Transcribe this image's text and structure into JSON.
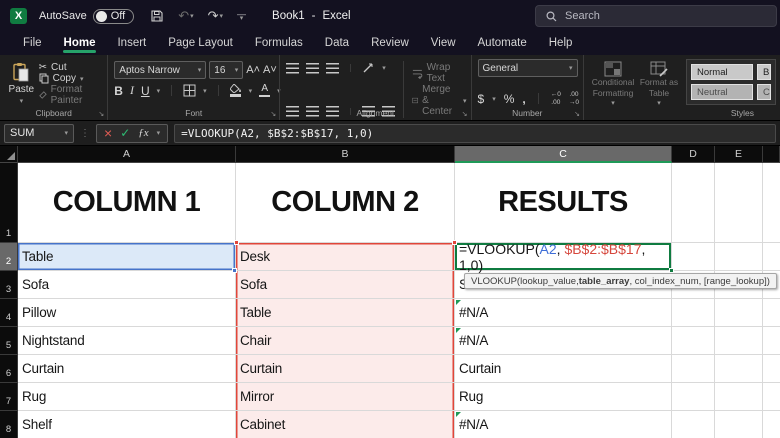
{
  "colors": {
    "accent_green": "#26a269",
    "selection_green": "#0f7b40",
    "ref_blue": "#4673c9",
    "ref_blue_fill": "#dce9f8",
    "ref_red": "#e0463a",
    "ref_red_fill": "#fcebea",
    "titlebar_bg": "#131120",
    "ribbon_bg": "#1f1f1f",
    "grid_line": "#d9d9d9"
  },
  "titlebar": {
    "autosave_label": "AutoSave",
    "autosave_state": "Off",
    "document_title": "Book1",
    "title_separator": "-",
    "app_name": "Excel",
    "search_placeholder": "Search"
  },
  "menubar": {
    "tabs": [
      "File",
      "Home",
      "Insert",
      "Page Layout",
      "Formulas",
      "Data",
      "Review",
      "View",
      "Automate",
      "Help"
    ],
    "active_tab": "Home"
  },
  "ribbon": {
    "clipboard": {
      "paste": "Paste",
      "cut": "Cut",
      "copy": "Copy",
      "format_painter": "Format Painter",
      "label": "Clipboard"
    },
    "font": {
      "name": "Aptos Narrow",
      "size": "16",
      "bold": "B",
      "italic": "I",
      "underline": "U",
      "label": "Font"
    },
    "alignment": {
      "wrap_text": "Wrap Text",
      "merge_center": "Merge & Center",
      "label": "Alignment"
    },
    "number": {
      "format": "General",
      "currency": "$",
      "percent": "%",
      "comma": ",",
      "inc_decimal": "←.0\n.00",
      "dec_decimal": ".00\n→.0",
      "label": "Number"
    },
    "styles": {
      "conditional_line1": "Conditional",
      "conditional_line2": "Formatting",
      "format_line1": "Format as",
      "format_line2": "Table",
      "gallery": [
        "Normal",
        "B",
        "Neutral",
        "C"
      ],
      "label": "Styles"
    }
  },
  "formula_bar": {
    "name_box": "SUM",
    "formula": "=VLOOKUP(A2, $B$2:$B$17, 1,0)"
  },
  "sheet": {
    "columns": [
      "A",
      "B",
      "C",
      "D",
      "E"
    ],
    "active_column": "C",
    "active_row": "2",
    "row1": {
      "n": "1",
      "a": "COLUMN 1",
      "b": "COLUMN 2",
      "c": "RESULTS"
    },
    "rows": [
      {
        "n": "2",
        "a": "Table",
        "b": "Desk",
        "c": "",
        "formula": true
      },
      {
        "n": "3",
        "a": "Sofa",
        "b": "Sofa",
        "c": "Sofa"
      },
      {
        "n": "4",
        "a": "Pillow",
        "b": "Table",
        "c": "#N/A",
        "err": true
      },
      {
        "n": "5",
        "a": "Nightstand",
        "b": "Chair",
        "c": "#N/A",
        "err": true
      },
      {
        "n": "6",
        "a": "Curtain",
        "b": "Curtain",
        "c": "Curtain"
      },
      {
        "n": "7",
        "a": "Rug",
        "b": "Mirror",
        "c": "Rug"
      },
      {
        "n": "8",
        "a": "Shelf",
        "b": "Cabinet",
        "c": "#N/A",
        "err": true
      }
    ],
    "formula_cell": {
      "p1": "=VLOOKUP(",
      "ref1": "A2",
      "p2": ", ",
      "ref2": "$B$2:$B$17",
      "p3": ", 1,0)"
    },
    "tooltip": {
      "p1": "VLOOKUP(lookup_value, ",
      "bold": "table_array",
      "p2": ", col_index_num, [range_lookup])"
    }
  }
}
